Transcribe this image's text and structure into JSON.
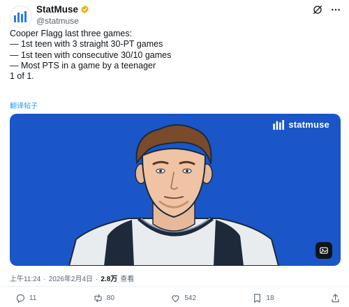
{
  "account": {
    "display_name": "StatMuse",
    "handle": "@statmuse"
  },
  "tweet": {
    "lines": [
      "Cooper Flagg last three games:",
      "",
      "— 1st teen with 3 straight 30-PT games",
      "— 1st teen with consecutive 30/10 games",
      "— Most PTS in a game by a teenager",
      "",
      "1 of 1."
    ],
    "translate_label": "翻译帖子"
  },
  "card": {
    "logo_text": "statmuse",
    "brand_color": "#1a56c8"
  },
  "meta": {
    "time": "上午11:24",
    "separator": "·",
    "date": "2026年2月4日",
    "separator2": "·",
    "views": "2.8万",
    "views_label": "查看"
  },
  "actions": {
    "replies": "11",
    "reposts": "80",
    "likes": "542",
    "bookmarks": "18"
  },
  "icons": {
    "verified": "verified-badge-icon",
    "grok": "grok-icon",
    "more": "more-icon",
    "expand": "expand-icon"
  }
}
